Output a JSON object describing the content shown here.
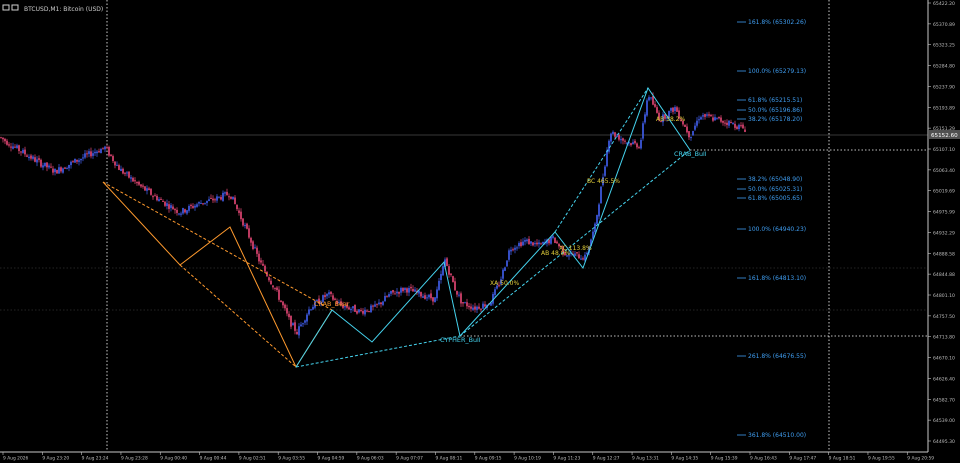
{
  "window": {
    "title": "BTCUSD,M1: Bitcoin (USD)"
  },
  "colors": {
    "background": "#000000",
    "candle_up": "#3b57d9",
    "candle_down": "#d0406a",
    "bear_pattern": "#ff9a2e",
    "bull_pattern": "#45d3ee",
    "fib_text": "#3f9df0",
    "pattern_text": "#e3cf3a",
    "grid_text": "#8a8a8a"
  },
  "chart_data": {
    "type": "candlestick",
    "symbol": "BTCUSD",
    "timeframe": "M1",
    "ylim": [
      64495,
      65430
    ],
    "price_axis": [
      "65422.20",
      "65370.89",
      "65323.25",
      "65284.80",
      "65237.90",
      "65193.89",
      "65151.29",
      "65107.10",
      "65063.40",
      "65019.69",
      "64975.99",
      "64932.29",
      "64888.58",
      "64844.88",
      "64801.10",
      "64757.50",
      "64713.80",
      "64670.10",
      "64626.40",
      "64582.70",
      "64539.00",
      "64495.30"
    ],
    "current_price": "65152.60",
    "time_axis": [
      "9 Aug 2026",
      "9 Aug 23:20",
      "9 Aug 23:24",
      "9 Aug 23:28",
      "9 Aug 00:40",
      "9 Aug 00:44",
      "9 Aug 02:51",
      "9 Aug 03:55",
      "9 Aug 04:59",
      "9 Aug 06:03",
      "9 Aug 07:07",
      "9 Aug 08:11",
      "9 Aug 09:15",
      "9 Aug 10:19",
      "9 Aug 11:23",
      "9 Aug 12:27",
      "9 Aug 13:31",
      "9 Aug 14:35",
      "9 Aug 15:39",
      "9 Aug 16:43",
      "9 Aug 17:47",
      "9 Aug 18:51",
      "9 Aug 19:55",
      "9 Aug 20:59"
    ],
    "fib_levels": [
      {
        "label": "161.8% (65302.26)",
        "price": 65302.26
      },
      {
        "label": "100.0% (65279.13)",
        "price": 65279.13
      },
      {
        "label": "61.8% (65215.51)",
        "price": 65215.51
      },
      {
        "label": "50.0% (65196.86)",
        "price": 65196.86
      },
      {
        "label": "38.2% (65178.20)",
        "price": 65178.2
      },
      {
        "label": "38.2% (65048.90)",
        "price": 65048.9
      },
      {
        "label": "50.0% (65025.31)",
        "price": 65025.31
      },
      {
        "label": "61.8% (65005.65)",
        "price": 65005.65
      },
      {
        "label": "100.0% (64940.23)",
        "price": 64940.23
      },
      {
        "label": "161.8% (64813.10)",
        "price": 64813.1
      },
      {
        "label": "261.8% (64676.55)",
        "price": 64676.55
      },
      {
        "label": "361.8% (64510.00)",
        "price": 64510.0
      }
    ],
    "patterns": [
      {
        "name": "CRAB_Bear"
      },
      {
        "name": "CYPHER_Bull"
      },
      {
        "name": "CRAB_Bull"
      }
    ],
    "ratios": [
      {
        "label": "XA 50.0%"
      },
      {
        "label": "AB 48.0%"
      },
      {
        "label": "XC 113.8%"
      },
      {
        "label": "BC 465.5%"
      },
      {
        "label": "AB 38.2%"
      }
    ],
    "series": [
      {
        "name": "price",
        "points": [
          [
            0,
            65148
          ],
          [
            14,
            65128
          ],
          [
            35,
            65100
          ],
          [
            55,
            65076
          ],
          [
            70,
            65092
          ],
          [
            95,
            65118
          ],
          [
            105,
            65126
          ],
          [
            120,
            65080
          ],
          [
            140,
            65045
          ],
          [
            160,
            65016
          ],
          [
            180,
            64990
          ],
          [
            200,
            65010
          ],
          [
            215,
            65018
          ],
          [
            230,
            65030
          ],
          [
            245,
            64960
          ],
          [
            260,
            64885
          ],
          [
            275,
            64830
          ],
          [
            290,
            64760
          ],
          [
            297,
            64738
          ],
          [
            310,
            64790
          ],
          [
            328,
            64818
          ],
          [
            340,
            64796
          ],
          [
            360,
            64782
          ],
          [
            375,
            64790
          ],
          [
            390,
            64818
          ],
          [
            405,
            64830
          ],
          [
            420,
            64818
          ],
          [
            435,
            64808
          ],
          [
            445,
            64890
          ],
          [
            455,
            64830
          ],
          [
            462,
            64800
          ],
          [
            475,
            64790
          ],
          [
            490,
            64800
          ],
          [
            500,
            64845
          ],
          [
            510,
            64915
          ],
          [
            525,
            64930
          ],
          [
            540,
            64920
          ],
          [
            553,
            64935
          ],
          [
            565,
            64905
          ],
          [
            585,
            64895
          ],
          [
            595,
            64960
          ],
          [
            610,
            65160
          ],
          [
            625,
            65140
          ],
          [
            640,
            65130
          ],
          [
            648,
            65240
          ],
          [
            660,
            65185
          ],
          [
            675,
            65210
          ],
          [
            690,
            65150
          ],
          [
            700,
            65195
          ],
          [
            715,
            65186
          ],
          [
            730,
            65178
          ],
          [
            745,
            65165
          ]
        ]
      }
    ]
  }
}
